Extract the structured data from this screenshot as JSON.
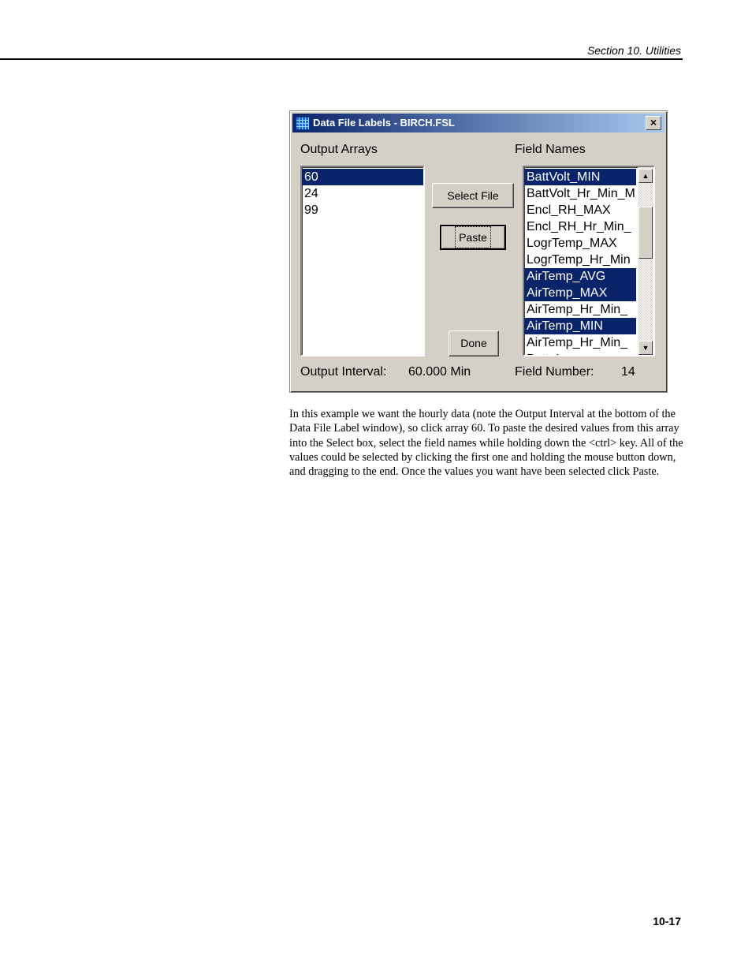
{
  "page": {
    "section_header": "Section 10.  Utilities",
    "page_number": "10-17",
    "body_text": "In this example we want the hourly data (note the Output Interval at the bottom of the Data File Label window), so click array 60.  To paste the desired values from this array into the Select box, select the field names while holding down the <ctrl> key.  All of the values could be selected by clicking the first one and holding the mouse button down, and dragging to the end.  Once the values you want have been selected click Paste."
  },
  "dialog": {
    "title": "Data File Labels - BIRCH.FSL",
    "close_label": "×",
    "output_arrays_label": "Output Arrays",
    "field_names_label": "Field Names",
    "output_arrays": [
      {
        "label": "60",
        "selected": true
      },
      {
        "label": "24",
        "selected": false
      },
      {
        "label": "99",
        "selected": false
      }
    ],
    "field_names": [
      {
        "label": "BattVolt_MIN",
        "selected": true
      },
      {
        "label": "BattVolt_Hr_Min_M",
        "selected": false
      },
      {
        "label": "Encl_RH_MAX",
        "selected": false
      },
      {
        "label": "Encl_RH_Hr_Min_",
        "selected": false
      },
      {
        "label": "LogrTemp_MAX",
        "selected": false
      },
      {
        "label": "LogrTemp_Hr_Min",
        "selected": false
      },
      {
        "label": "AirTemp_AVG",
        "selected": true
      },
      {
        "label": "AirTemp_MAX",
        "selected": true
      },
      {
        "label": "AirTemp_Hr_Min_",
        "selected": false
      },
      {
        "label": "AirTemp_MIN",
        "selected": true
      },
      {
        "label": "AirTemp_Hr_Min_",
        "selected": false
      },
      {
        "label": "Batt_Loss",
        "selected": false
      }
    ],
    "select_file_label": "Select File",
    "paste_label": "Paste",
    "done_label": "Done",
    "output_interval_label": "Output Interval:",
    "output_interval_value": "60.000 Min",
    "field_number_label": "Field Number:",
    "field_number_value": "14",
    "scroll_up_icon": "▲",
    "scroll_down_icon": "▼"
  }
}
